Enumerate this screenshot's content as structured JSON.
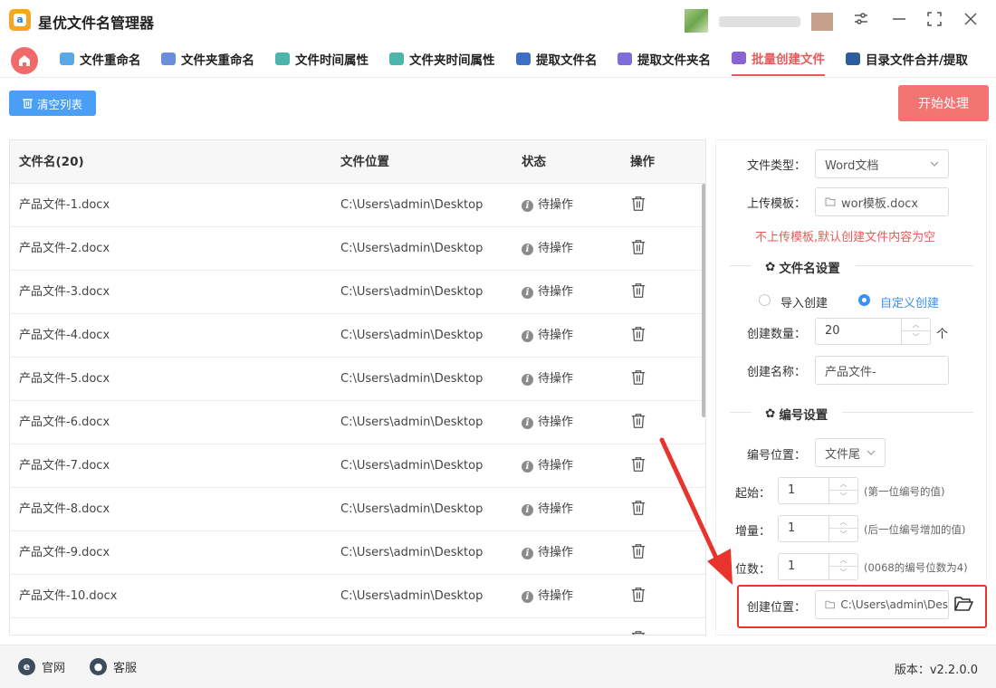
{
  "app": {
    "title": "星优文件名管理器"
  },
  "nav": {
    "tabs": [
      {
        "label": "文件重命名",
        "icon": "file-rename-icon",
        "color": "#5aa9e6"
      },
      {
        "label": "文件夹重命名",
        "icon": "folder-rename-icon",
        "color": "#6a8fd8"
      },
      {
        "label": "文件时间属性",
        "icon": "file-time-icon",
        "color": "#4db6ac"
      },
      {
        "label": "文件夹时间属性",
        "icon": "folder-time-icon",
        "color": "#4db6ac"
      },
      {
        "label": "提取文件名",
        "icon": "extract-filename-icon",
        "color": "#3f6fc4"
      },
      {
        "label": "提取文件夹名",
        "icon": "extract-foldername-icon",
        "color": "#7e6fd8"
      },
      {
        "label": "批量创建文件",
        "icon": "batch-create-icon",
        "color": "#8a63d2",
        "active": true
      },
      {
        "label": "目录文件合并/提取",
        "icon": "merge-extract-icon",
        "color": "#2f5d9c"
      }
    ]
  },
  "toolbar": {
    "clear_label": "清空列表",
    "start_label": "开始处理"
  },
  "table": {
    "columns": [
      "文件名(20)",
      "文件位置",
      "状态",
      "操作"
    ],
    "rows": [
      {
        "name": "产品文件-1.docx",
        "path": "C:\\Users\\admin\\Desktop",
        "status": "待操作"
      },
      {
        "name": "产品文件-2.docx",
        "path": "C:\\Users\\admin\\Desktop",
        "status": "待操作"
      },
      {
        "name": "产品文件-3.docx",
        "path": "C:\\Users\\admin\\Desktop",
        "status": "待操作"
      },
      {
        "name": "产品文件-4.docx",
        "path": "C:\\Users\\admin\\Desktop",
        "status": "待操作"
      },
      {
        "name": "产品文件-5.docx",
        "path": "C:\\Users\\admin\\Desktop",
        "status": "待操作"
      },
      {
        "name": "产品文件-6.docx",
        "path": "C:\\Users\\admin\\Desktop",
        "status": "待操作"
      },
      {
        "name": "产品文件-7.docx",
        "path": "C:\\Users\\admin\\Desktop",
        "status": "待操作"
      },
      {
        "name": "产品文件-8.docx",
        "path": "C:\\Users\\admin\\Desktop",
        "status": "待操作"
      },
      {
        "name": "产品文件-9.docx",
        "path": "C:\\Users\\admin\\Desktop",
        "status": "待操作"
      },
      {
        "name": "产品文件-10.docx",
        "path": "C:\\Users\\admin\\Desktop",
        "status": "待操作"
      }
    ]
  },
  "settings": {
    "file_type_label": "文件类型：",
    "file_type_value": "Word文档",
    "template_label": "上传模板：",
    "template_value": "wor模板.docx",
    "template_warning": "不上传模板,默认创建文件内容为空",
    "filename_section": "文件名设置",
    "radio_import": "导入创建",
    "radio_custom": "自定义创建",
    "count_label": "创建数量：",
    "count_value": "20",
    "count_unit": "个",
    "name_label": "创建名称：",
    "name_value": "产品文件-",
    "numbering_section": "编号设置",
    "position_label": "编号位置：",
    "position_value": "文件尾",
    "start_label": "起始：",
    "start_value": "1",
    "start_hint": "(第一位编号的值)",
    "step_label": "增量：",
    "step_value": "1",
    "step_hint": "(后一位编号增加的值)",
    "digits_label": "位数：",
    "digits_value": "1",
    "digits_hint": "(0068的编号位数为4)",
    "location_label": "创建位置：",
    "location_value": "C:\\Users\\admin\\Des"
  },
  "footer": {
    "website": "官网",
    "service": "客服",
    "version": "版本：v2.2.0.0"
  },
  "colors": {
    "accent_red": "#f47373",
    "accent_blue": "#4a9ff5",
    "highlight": "#e8342c"
  }
}
